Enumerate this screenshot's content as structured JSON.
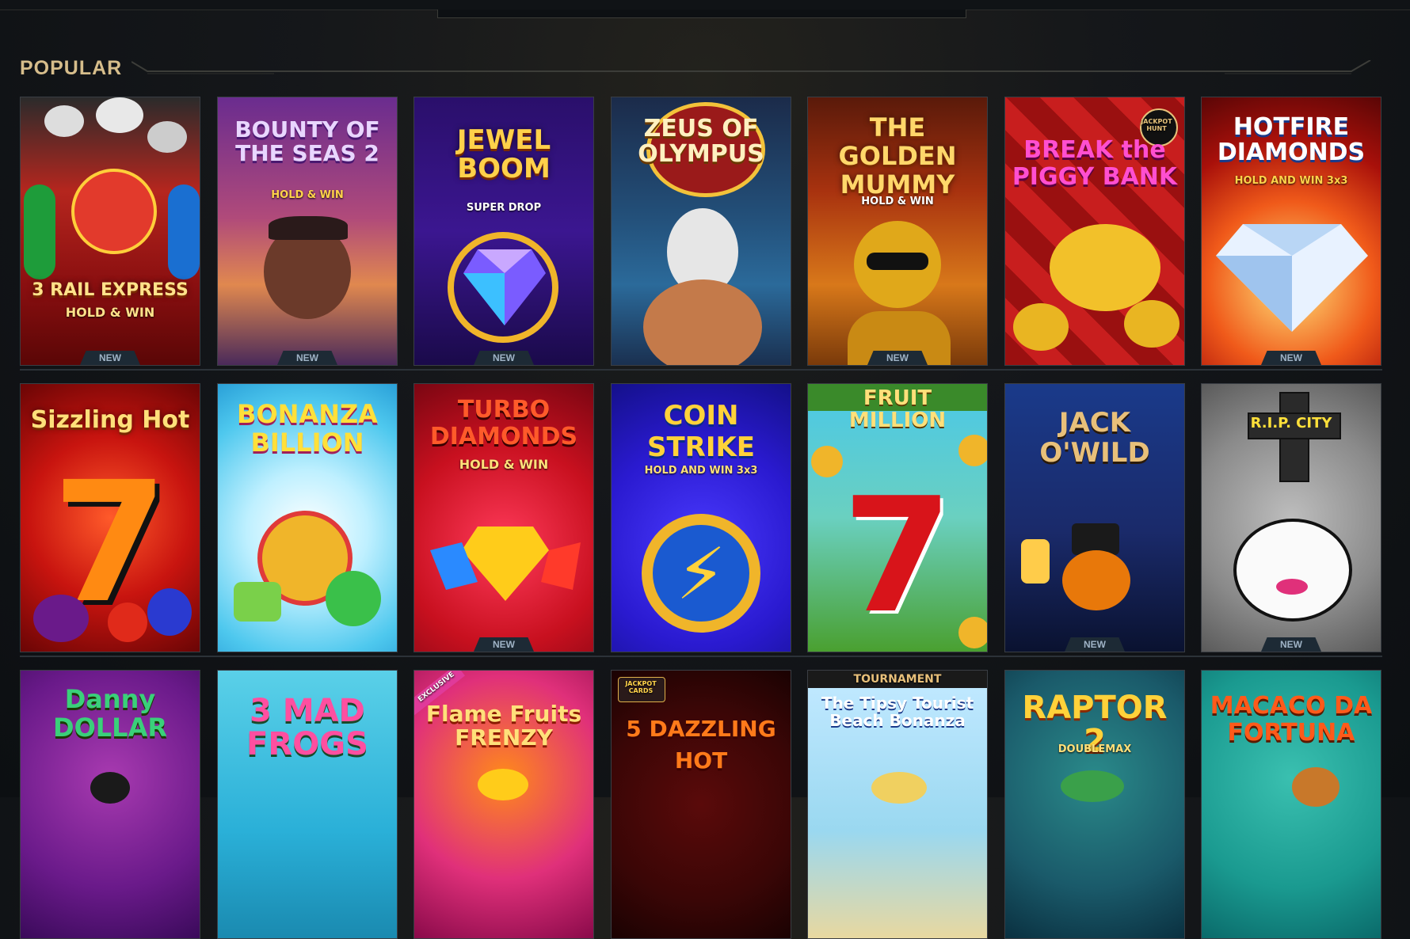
{
  "section": {
    "title": "POPULAR"
  },
  "badge_new": "NEW",
  "tiles": [
    {
      "name": "3 RAIL EXPRESS",
      "sub": "HOLD & WIN",
      "badge": "NEW"
    },
    {
      "name": "BOUNTY OF THE SEAS 2",
      "sub": "HOLD & WIN",
      "badge": "NEW"
    },
    {
      "name": "JEWEL BOOM",
      "sub": "SUPER DROP",
      "badge": "NEW"
    },
    {
      "name": "ZEUS OF OLYMPUS",
      "sub": "",
      "badge": ""
    },
    {
      "name": "THE GOLDEN MUMMY",
      "sub": "HOLD & WIN",
      "badge": "NEW"
    },
    {
      "name": "BREAK the PIGGY BANK",
      "sub": "JACKPOT HUNT",
      "badge": ""
    },
    {
      "name": "HOTFIRE DIAMONDS",
      "sub": "HOLD AND WIN 3x3",
      "badge": "NEW"
    },
    {
      "name": "Sizzling Hot",
      "sub": "",
      "badge": ""
    },
    {
      "name": "BONANZA BILLION",
      "sub": "",
      "badge": ""
    },
    {
      "name": "TURBO DIAMONDS",
      "sub": "HOLD & WIN",
      "badge": "NEW"
    },
    {
      "name": "COIN STRIKE",
      "sub": "HOLD AND WIN 3x3",
      "badge": ""
    },
    {
      "name": "FRUIT MILLION",
      "sub": "",
      "badge": ""
    },
    {
      "name": "JACK O'WILD",
      "sub": "",
      "badge": "NEW"
    },
    {
      "name": "R.I.P. CITY",
      "sub": "",
      "badge": "NEW"
    },
    {
      "name": "Danny DOLLAR",
      "sub": "",
      "badge": ""
    },
    {
      "name": "3 MAD FROGS",
      "sub": "",
      "badge": ""
    },
    {
      "name": "Flame Fruits FRENZY",
      "sub": "EXCLUSIVE",
      "badge": ""
    },
    {
      "name": "5 DAZZLING HOT",
      "sub": "JACKPOT CARDS",
      "badge": ""
    },
    {
      "name": "The Tipsy Tourist Beach Bonanza",
      "sub": "TOURNAMENT",
      "badge": ""
    },
    {
      "name": "RAPTOR 2",
      "sub": "DOUBLEMAX",
      "badge": ""
    },
    {
      "name": "MACACO DA FORTUNA",
      "sub": "",
      "badge": ""
    }
  ],
  "colors": {
    "accent_gold": "#d6bd8b",
    "tile_border": "#3a3e44",
    "badge_bg": "#1d2a35"
  }
}
